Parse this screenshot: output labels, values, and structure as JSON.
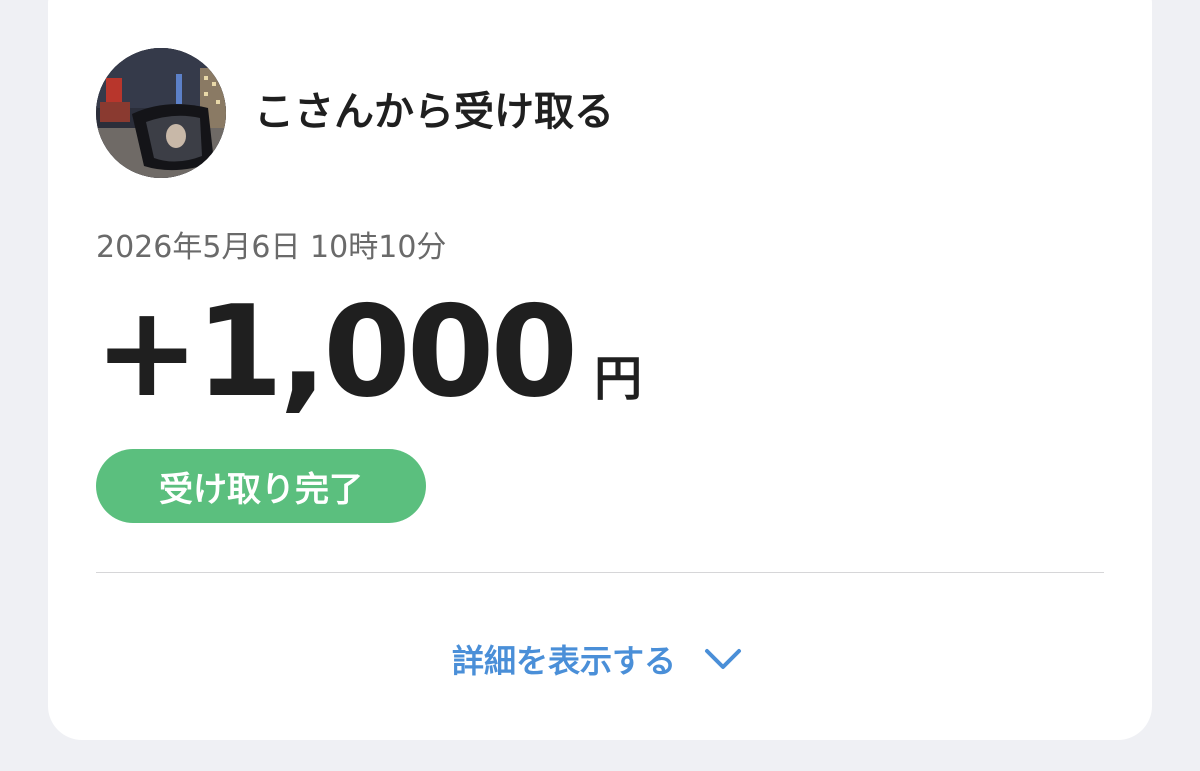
{
  "transaction": {
    "sender_title": "こさんから受け取る",
    "datetime": "2026年5月6日 10時10分",
    "amount": "+1,000",
    "currency": "円",
    "status": "受け取り完了"
  },
  "details_toggle": {
    "label": "詳細を表示する",
    "icon": "chevron-down-icon"
  },
  "colors": {
    "background": "#eff0f4",
    "card": "#ffffff",
    "status_green": "#5bbf7e",
    "link_blue": "#4a8fd8",
    "primary_text": "#1f1f1f",
    "secondary_text": "#6a6a6a"
  }
}
